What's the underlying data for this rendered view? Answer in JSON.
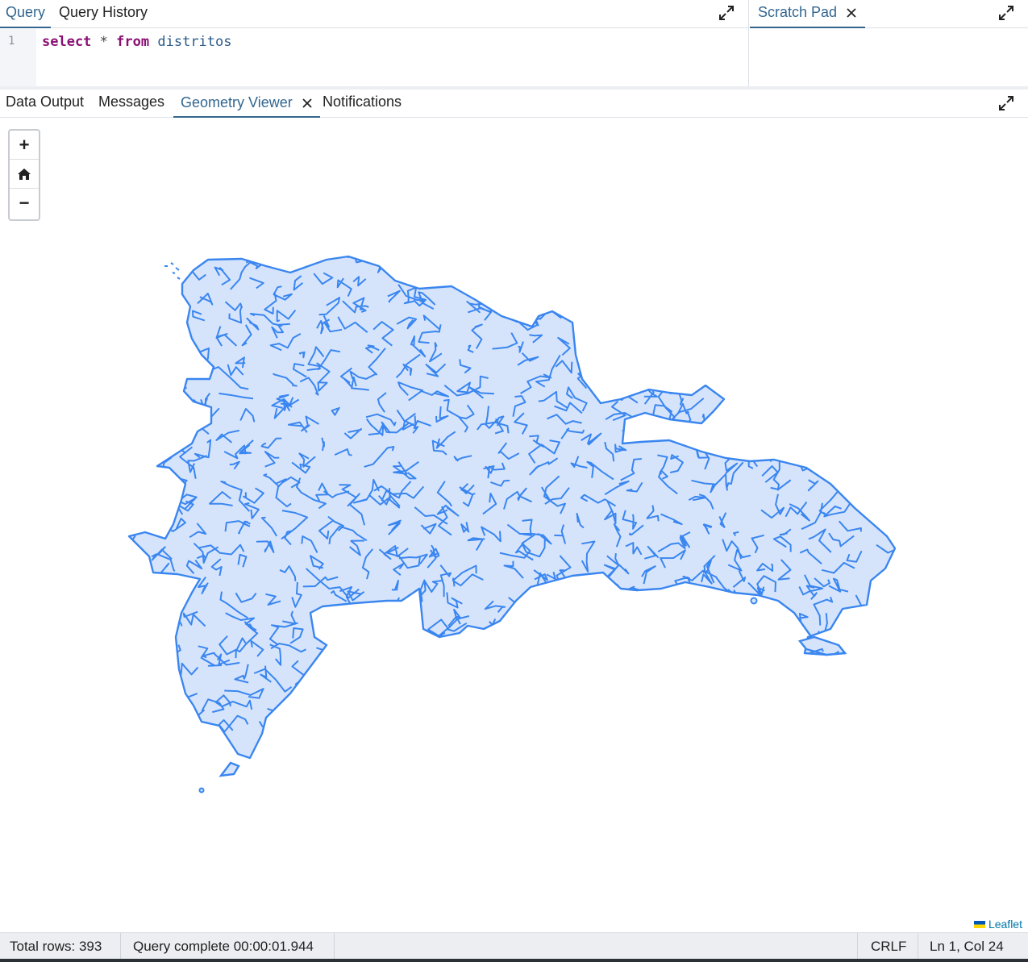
{
  "query_tabs": {
    "query": "Query",
    "history": "Query History"
  },
  "scratch": {
    "title": "Scratch Pad",
    "close_icon": "close-icon"
  },
  "editor": {
    "line_number": "1",
    "keyword_select": "select",
    "star": "*",
    "keyword_from": "from",
    "table": "distritos"
  },
  "result_tabs": {
    "data_output": "Data Output",
    "messages": "Messages",
    "geometry_viewer": "Geometry Viewer",
    "notifications": "Notifications"
  },
  "map": {
    "zoom_in": "+",
    "zoom_out": "−",
    "home_icon": "home-icon",
    "attribution": "Leaflet",
    "fill_color": "#d6e4fb",
    "stroke_color": "#3a86f0"
  },
  "status": {
    "total_rows": "Total rows: 393",
    "query_complete": "Query complete 00:00:01.944",
    "line_ending": "CRLF",
    "cursor": "Ln 1, Col 24"
  },
  "colors": {
    "accent": "#326690",
    "keyword": "#8a1074",
    "identifier": "#2a5a8a"
  }
}
